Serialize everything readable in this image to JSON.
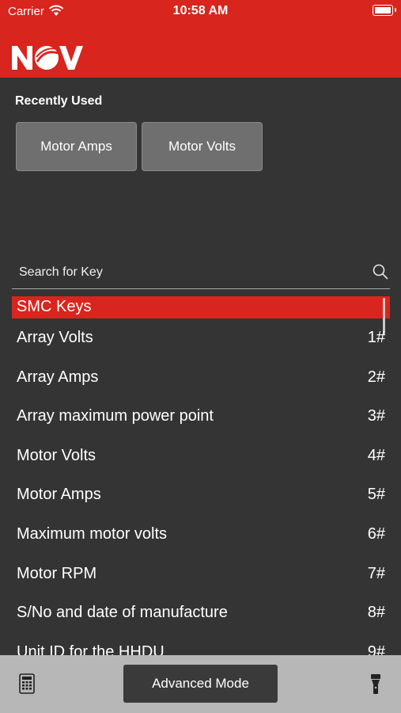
{
  "status": {
    "carrier": "Carrier",
    "time": "10:58 AM"
  },
  "brand": {
    "logo_text": "NOV",
    "accent": "#d8251d",
    "background": "#343434"
  },
  "recent": {
    "title": "Recently Used",
    "buttons": [
      "Motor Amps",
      "Motor Volts"
    ]
  },
  "search": {
    "placeholder": "Search for Key",
    "icon": "search-icon"
  },
  "section": {
    "title": "SMC Keys"
  },
  "items": [
    {
      "label": "Array Volts",
      "key": "1#"
    },
    {
      "label": "Array Amps",
      "key": "2#"
    },
    {
      "label": "Array maximum power point",
      "key": "3#"
    },
    {
      "label": "Motor Volts",
      "key": "4#"
    },
    {
      "label": "Motor Amps",
      "key": "5#"
    },
    {
      "label": "Maximum motor volts",
      "key": "6#"
    },
    {
      "label": "Motor RPM",
      "key": "7#"
    },
    {
      "label": "S/No and date of manufacture",
      "key": "8#"
    },
    {
      "label": "Unit ID for the HHDU",
      "key": "9#"
    }
  ],
  "toolbar": {
    "advanced_label": "Advanced Mode",
    "left_icon": "keypad-icon",
    "right_icon": "flashlight-icon"
  }
}
